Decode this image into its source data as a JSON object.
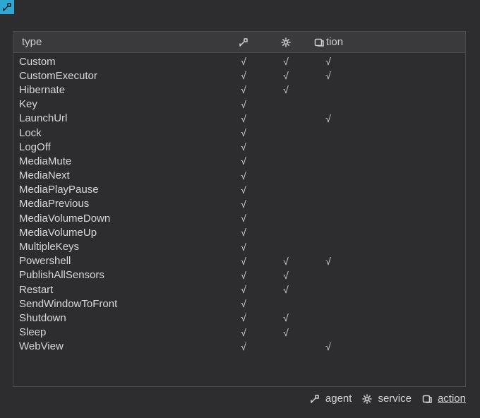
{
  "check_mark": "√",
  "header": {
    "type_label": "type",
    "action_label": "tion"
  },
  "rows": [
    {
      "type": "Custom",
      "agent": true,
      "service": true,
      "action": true
    },
    {
      "type": "CustomExecutor",
      "agent": true,
      "service": true,
      "action": true
    },
    {
      "type": "Hibernate",
      "agent": true,
      "service": true,
      "action": false
    },
    {
      "type": "Key",
      "agent": true,
      "service": false,
      "action": false
    },
    {
      "type": "LaunchUrl",
      "agent": true,
      "service": false,
      "action": true
    },
    {
      "type": "Lock",
      "agent": true,
      "service": false,
      "action": false
    },
    {
      "type": "LogOff",
      "agent": true,
      "service": false,
      "action": false
    },
    {
      "type": "MediaMute",
      "agent": true,
      "service": false,
      "action": false
    },
    {
      "type": "MediaNext",
      "agent": true,
      "service": false,
      "action": false
    },
    {
      "type": "MediaPlayPause",
      "agent": true,
      "service": false,
      "action": false
    },
    {
      "type": "MediaPrevious",
      "agent": true,
      "service": false,
      "action": false
    },
    {
      "type": "MediaVolumeDown",
      "agent": true,
      "service": false,
      "action": false
    },
    {
      "type": "MediaVolumeUp",
      "agent": true,
      "service": false,
      "action": false
    },
    {
      "type": "MultipleKeys",
      "agent": true,
      "service": false,
      "action": false
    },
    {
      "type": "Powershell",
      "agent": true,
      "service": true,
      "action": true
    },
    {
      "type": "PublishAllSensors",
      "agent": true,
      "service": true,
      "action": false
    },
    {
      "type": "Restart",
      "agent": true,
      "service": true,
      "action": false
    },
    {
      "type": "SendWindowToFront",
      "agent": true,
      "service": false,
      "action": false
    },
    {
      "type": "Shutdown",
      "agent": true,
      "service": true,
      "action": false
    },
    {
      "type": "Sleep",
      "agent": true,
      "service": true,
      "action": false
    },
    {
      "type": "WebView",
      "agent": true,
      "service": false,
      "action": true
    }
  ],
  "legend": {
    "agent": "agent",
    "service": "service",
    "action": "action"
  }
}
